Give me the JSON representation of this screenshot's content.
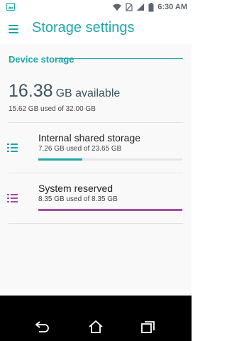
{
  "status_bar": {
    "left_icon": "gallery-icon",
    "icons": [
      "wifi-icon",
      "sim-off-icon",
      "signal-icon",
      "battery-icon"
    ],
    "time": "6:30 AM"
  },
  "app_bar": {
    "menu_icon": "hamburger-icon",
    "title": "Storage settings"
  },
  "device_storage": {
    "header": "Device storage",
    "available_amount": "16.38",
    "available_unit": "GB available",
    "used_summary": "15.62 GB used of 32.00 GB"
  },
  "storage_items": [
    {
      "title": "Internal shared storage",
      "subtitle": "7.26 GB used of 23.65 GB",
      "usage_fraction": 0.307,
      "color": "#1fa5a9",
      "icon": "storage-list-icon"
    },
    {
      "title": "System reserved",
      "subtitle": "8.35 GB used of 8.35 GB",
      "usage_fraction": 1.0,
      "color": "#a34da6",
      "icon": "storage-list-icon"
    }
  ],
  "nav_bar": {
    "buttons": [
      "back-icon",
      "home-icon",
      "recents-icon"
    ]
  },
  "colors": {
    "accent": "#1fa5a9",
    "system_reserved": "#a34da6",
    "nav_background": "#000000"
  }
}
